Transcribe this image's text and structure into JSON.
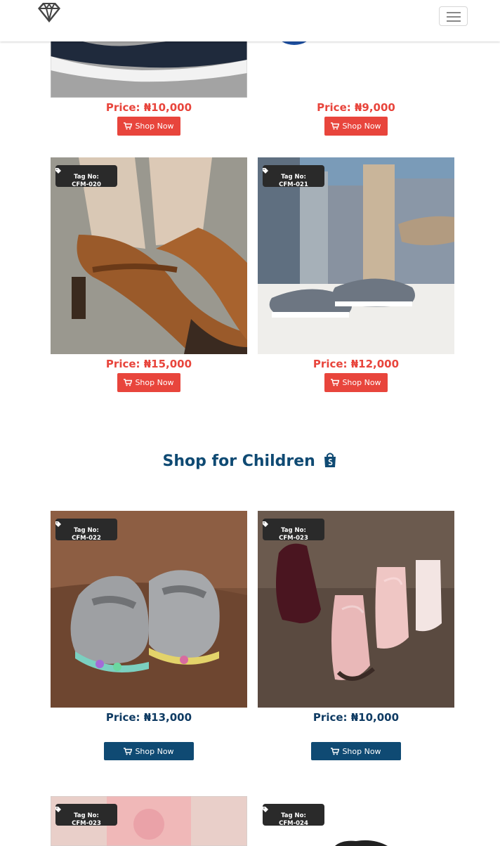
{
  "nav": {
    "logo": "diamond-logo",
    "menu_icon": "hamburger-icon"
  },
  "men_products": [
    {
      "price": "Price: ₦10,000",
      "button": "Shop Now"
    },
    {
      "price": "Price: ₦9,000",
      "button": "Shop Now"
    },
    {
      "tag_label": "Tag No:",
      "tag_no": "CFM-020",
      "price": "Price: ₦15,000",
      "button": "Shop Now"
    },
    {
      "tag_label": "Tag No:",
      "tag_no": "CFM-021",
      "price": "Price: ₦12,000",
      "button": "Shop Now"
    }
  ],
  "children_section": {
    "title": "Shop for Children",
    "icon": "shopping-bag-icon"
  },
  "children_products": [
    {
      "tag_label": "Tag No:",
      "tag_no": "CFM-022",
      "price": "Price: ₦13,000",
      "button": "Shop Now"
    },
    {
      "tag_label": "Tag No:",
      "tag_no": "CFM-023",
      "price": "Price: ₦10,000",
      "button": "Shop Now"
    },
    {
      "tag_label": "Tag No:",
      "tag_no": "CFM-023"
    },
    {
      "tag_label": "Tag No:",
      "tag_no": "CFM-024"
    }
  ],
  "colors": {
    "price_red": "#e8453c",
    "price_blue": "#0f3b63",
    "button_blue": "#0f4a73",
    "tag_bg": "#2a2a2a"
  }
}
